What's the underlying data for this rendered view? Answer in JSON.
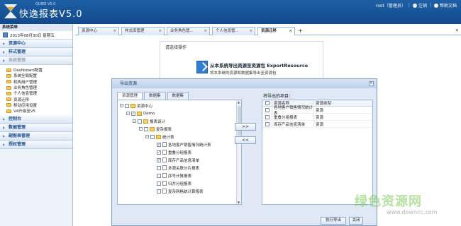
{
  "header": {
    "app_small": "QUIEE V5.0",
    "app_title": "快逸报表V5.0",
    "user": "root（管理员）",
    "logout": "注销",
    "help": "帮助文档"
  },
  "sidebar": {
    "title": "系统菜单",
    "date": "2013年08月30日 星期五",
    "groups_top": [
      "资源中心",
      "样式管理",
      "系统管理"
    ],
    "items": [
      "Dashboard配置",
      "系统全局配置",
      "机构用户管理",
      "业务角色管理",
      "个人信息管理",
      "资源迁移",
      "移动应用设置",
      "V4升级至V5"
    ],
    "groups_bottom": [
      "控制台",
      "数据管理",
      "副报表管理",
      "授权管理"
    ]
  },
  "tabs": [
    {
      "label": "资源中心"
    },
    {
      "label": "样式库管理"
    },
    {
      "label": "业务角色管..."
    },
    {
      "label": "个人信息管..."
    },
    {
      "label": "资源迁移"
    }
  ],
  "tab_add": "+",
  "operation_panel": {
    "title": "请选择操作",
    "main": "从本系统导出资源至资源包 ExportResource",
    "sub": "将本系统的资源和数据集导出至资源包"
  },
  "modal": {
    "title": "导出资源",
    "inner_tabs": [
      "资源管理",
      "数据集",
      "数据集"
    ],
    "tree": [
      {
        "label": "资源中心",
        "level": 0,
        "toggle": "-",
        "checked": false,
        "icon": "folder"
      },
      {
        "label": "Demo",
        "level": 1,
        "toggle": "-",
        "checked": true,
        "icon": "folder"
      },
      {
        "label": "报表设计",
        "level": 2,
        "toggle": "-",
        "checked": false,
        "icon": "folder"
      },
      {
        "label": "复杂报表",
        "level": 3,
        "toggle": "-",
        "checked": false,
        "icon": "folder"
      },
      {
        "label": "统计表",
        "level": 4,
        "toggle": "-",
        "checked": false,
        "icon": "folder"
      },
      {
        "label": "各地客户销售情况统计表",
        "level": 5,
        "toggle": "",
        "checked": true,
        "icon": "doc"
      },
      {
        "label": "重叠分组报表",
        "level": 5,
        "toggle": "",
        "checked": true,
        "icon": "doc"
      },
      {
        "label": "库存产品信息清单",
        "level": 5,
        "toggle": "",
        "checked": true,
        "icon": "doc"
      },
      {
        "label": "多源关联分片报表",
        "level": 5,
        "toggle": "",
        "checked": false,
        "icon": "doc"
      },
      {
        "label": "序号计算报表",
        "level": 5,
        "toggle": "",
        "checked": false,
        "icon": "doc"
      },
      {
        "label": "归并分组报表",
        "level": 5,
        "toggle": "",
        "checked": false,
        "icon": "doc"
      },
      {
        "label": "复杂网格统计算报表",
        "level": 5,
        "toggle": "",
        "checked": false,
        "icon": "doc"
      }
    ],
    "move_right": ">>",
    "move_left": "<<",
    "right_label": "将导出的项目：",
    "columns": [
      "资源名称",
      "资源类型"
    ],
    "rows": [
      {
        "name": "各地客户销售情况统计表",
        "type": "资源"
      },
      {
        "name": "重叠分组报表",
        "type": "资源"
      },
      {
        "name": "库存产品信息清单",
        "type": "资源"
      }
    ],
    "export_button": "执行导出",
    "close_button": "关闭"
  },
  "watermark": {
    "main": "绿色资源网",
    "sub": "www.downcc.com"
  }
}
